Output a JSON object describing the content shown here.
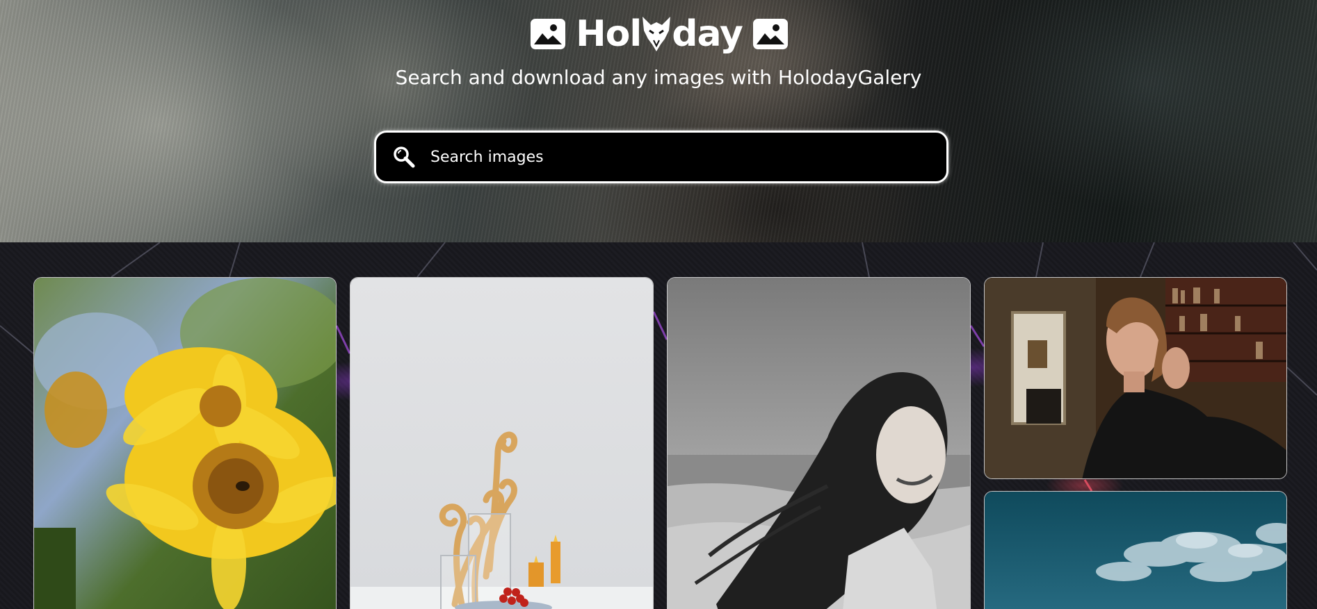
{
  "header": {
    "title": "Holiday",
    "title_left": "Hol",
    "title_right": "day",
    "tagline": "Search and download any images with HolodayGalery",
    "left_icon": "image-icon",
    "right_icon": "image-icon",
    "logo_mark": "wolf-head-logo"
  },
  "search": {
    "placeholder": "Search images",
    "value": "",
    "icon": "search-icon"
  },
  "gallery": {
    "images": [
      {
        "subject": "sunflower-photo"
      },
      {
        "subject": "still-life-photo"
      },
      {
        "subject": "woman-beach-bw-photo"
      },
      {
        "subject": "woman-portrait-photo"
      },
      {
        "subject": "sky-clouds-photo"
      }
    ]
  },
  "colors": {
    "search_bg": "#000000",
    "search_border": "#ffffff",
    "card_border": "#ffffff",
    "text": "#ffffff"
  }
}
